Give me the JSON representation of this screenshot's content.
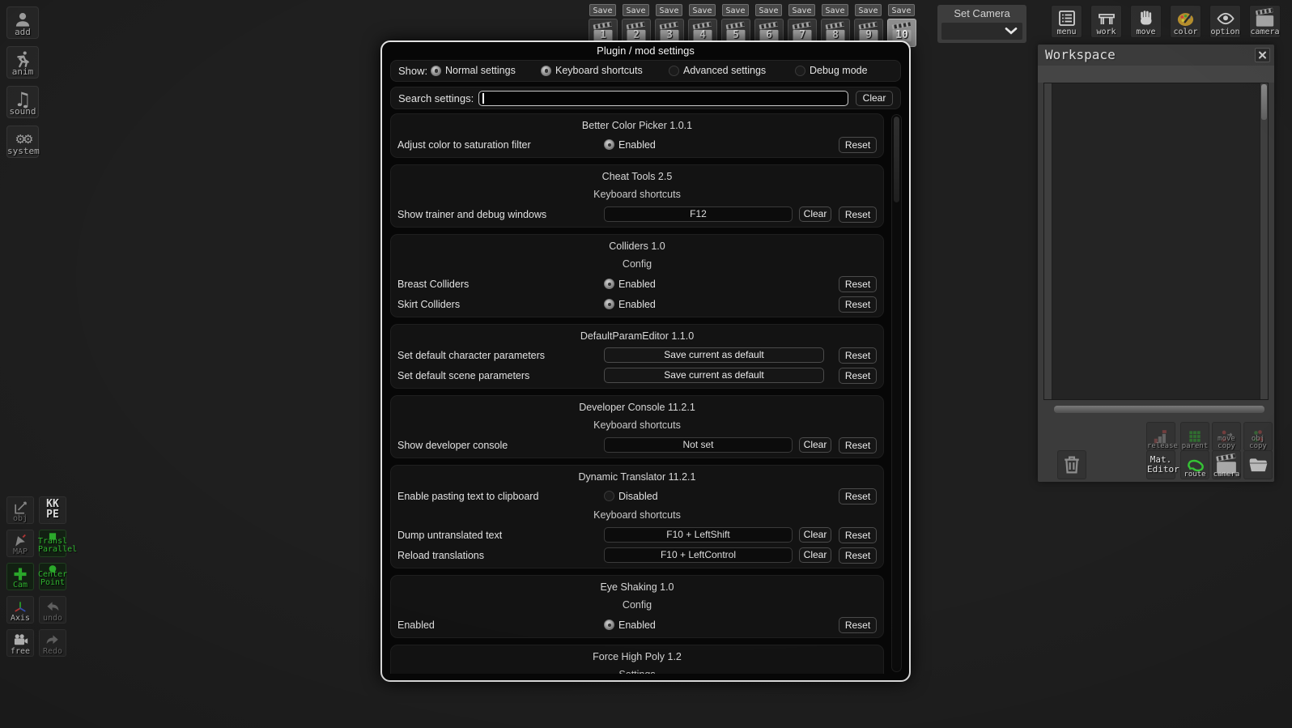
{
  "left_toolbar": {
    "items": [
      {
        "id": "add",
        "label": "add",
        "icon": "person-add-icon"
      },
      {
        "id": "anim",
        "label": "anim",
        "icon": "runner-icon"
      },
      {
        "id": "sound",
        "label": "sound",
        "icon": "music-note-icon"
      },
      {
        "id": "system",
        "label": "system",
        "icon": "gears-icon"
      }
    ]
  },
  "save_row": {
    "save_label": "Save",
    "icon": "clapperboard-icon",
    "slots": [
      {
        "num": "1"
      },
      {
        "num": "2"
      },
      {
        "num": "3"
      },
      {
        "num": "4"
      },
      {
        "num": "5"
      },
      {
        "num": "6"
      },
      {
        "num": "7"
      },
      {
        "num": "8"
      },
      {
        "num": "9"
      },
      {
        "num": "10",
        "active": true
      }
    ]
  },
  "set_camera": {
    "label": "Set Camera",
    "value": "",
    "icon": "chevron-down-icon"
  },
  "top_toolbar": {
    "items": [
      {
        "id": "menu",
        "label": "menu",
        "icon": "menu-list-icon"
      },
      {
        "id": "work",
        "label": "work",
        "icon": "desk-icon"
      },
      {
        "id": "move",
        "label": "move",
        "icon": "hand-icon"
      },
      {
        "id": "color",
        "label": "color",
        "icon": "palette-icon"
      },
      {
        "id": "option",
        "label": "option",
        "icon": "eye-icon"
      },
      {
        "id": "camera",
        "label": "camera",
        "icon": "clapperboard-icon"
      }
    ]
  },
  "side_tools": {
    "items": [
      {
        "id": "obj",
        "label": "obj",
        "icon": "edit-square-icon",
        "style": "dim"
      },
      {
        "id": "kk-pe",
        "label": "KK\nPE",
        "icon": "",
        "style": "plainbig"
      },
      {
        "id": "map",
        "label": "MAP",
        "icon": "cursor-arrow-icon",
        "style": "dim"
      },
      {
        "id": "transl-parallel",
        "label": "Transl\nParallel",
        "icon": "green-square-icon",
        "style": "green two"
      },
      {
        "id": "cam",
        "label": "Cam",
        "icon": "green-plus-icon",
        "style": "green"
      },
      {
        "id": "center-point",
        "label": "Center\nPoint",
        "icon": "green-dot-icon",
        "style": "green two"
      },
      {
        "id": "axis",
        "label": "Axis",
        "icon": "axis-icon",
        "style": ""
      },
      {
        "id": "undo",
        "label": "undo",
        "icon": "undo-arrow-icon",
        "style": "dim"
      },
      {
        "id": "free",
        "label": "free",
        "icon": "movie-camera-icon",
        "style": ""
      },
      {
        "id": "redo",
        "label": "Redo",
        "icon": "redo-arrow-icon",
        "style": "dim"
      }
    ]
  },
  "workspace": {
    "title": "Workspace",
    "close_icon": "close-icon",
    "buttons_row1": [
      {
        "id": "release",
        "label": "release",
        "icon": "release-icon",
        "style": "dim"
      },
      {
        "id": "parent",
        "label": "parent",
        "icon": "grid-green-icon",
        "style": "dim"
      },
      {
        "id": "move-copy",
        "label": "move\ncopy",
        "icon": "move-copy-icon",
        "style": "dim"
      },
      {
        "id": "obj-copy",
        "label": "obj\ncopy",
        "icon": "obj-copy-icon",
        "style": "dim"
      }
    ],
    "buttons_row2": [
      {
        "id": "trash",
        "label": "",
        "icon": "trash-icon",
        "style": ""
      },
      {
        "id": "mat-editor",
        "label": "Mat.\nEditor",
        "icon": "",
        "style": "texty"
      },
      {
        "id": "route",
        "label": "route",
        "icon": "route-icon",
        "style": ""
      },
      {
        "id": "camera",
        "label": "camera",
        "icon": "clapperboard-icon",
        "style": ""
      },
      {
        "id": "folder",
        "label": "",
        "icon": "folder-icon",
        "style": ""
      }
    ]
  },
  "dialog": {
    "title": "Plugin / mod settings",
    "show_label": "Show:",
    "show_options": [
      {
        "label": "Normal settings",
        "on": true
      },
      {
        "label": "Keyboard shortcuts",
        "on": true
      },
      {
        "label": "Advanced settings",
        "on": false
      },
      {
        "label": "Debug mode",
        "on": false
      }
    ],
    "search_label": "Search settings:",
    "search_value": "",
    "clear_label": "Clear",
    "reset_label": "Reset",
    "sections": [
      {
        "title": "Better Color Picker 1.0.1",
        "rows": [
          {
            "type": "toggle",
            "label": "Adjust color to saturation filter",
            "value": "Enabled",
            "on": true
          }
        ]
      },
      {
        "title": "Cheat Tools 2.5",
        "rows": [
          {
            "type": "subheader",
            "label": "Keyboard shortcuts"
          },
          {
            "type": "keybind",
            "label": "Show trainer and debug windows",
            "value": "F12"
          }
        ]
      },
      {
        "title": "Colliders 1.0",
        "rows": [
          {
            "type": "subheader",
            "label": "Config"
          },
          {
            "type": "toggle",
            "label": "Breast Colliders",
            "value": "Enabled",
            "on": true
          },
          {
            "type": "toggle",
            "label": "Skirt Colliders",
            "value": "Enabled",
            "on": true
          }
        ]
      },
      {
        "title": "DefaultParamEditor 1.1.0",
        "rows": [
          {
            "type": "action",
            "label": "Set default character parameters",
            "button": "Save current as default"
          },
          {
            "type": "action",
            "label": "Set default scene parameters",
            "button": "Save current as default"
          }
        ]
      },
      {
        "title": "Developer Console 11.2.1",
        "rows": [
          {
            "type": "subheader",
            "label": "Keyboard shortcuts"
          },
          {
            "type": "keybind",
            "label": "Show developer console",
            "value": "Not set"
          }
        ]
      },
      {
        "title": "Dynamic Translator 11.2.1",
        "rows": [
          {
            "type": "toggle",
            "label": "Enable pasting text to clipboard",
            "value": "Disabled",
            "on": false
          },
          {
            "type": "subheader",
            "label": "Keyboard shortcuts"
          },
          {
            "type": "keybind",
            "label": "Dump untranslated text",
            "value": "F10 + LeftShift"
          },
          {
            "type": "keybind",
            "label": "Reload translations",
            "value": "F10 + LeftControl"
          }
        ]
      },
      {
        "title": "Eye Shaking 1.0",
        "rows": [
          {
            "type": "subheader",
            "label": "Config"
          },
          {
            "type": "toggle",
            "label": "Enabled",
            "value": "Enabled",
            "on": true
          }
        ]
      },
      {
        "title": "Force High Poly 1.2",
        "rows": [
          {
            "type": "subheader",
            "label": "Settings"
          }
        ]
      }
    ]
  }
}
